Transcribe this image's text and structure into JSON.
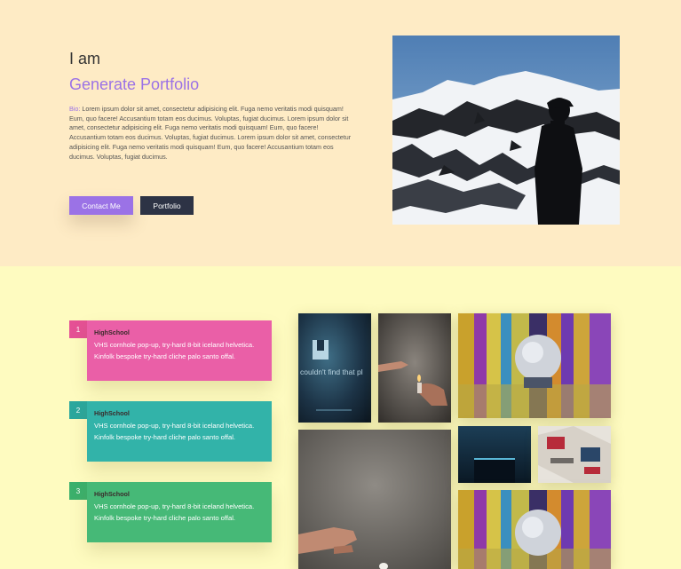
{
  "hero": {
    "greeting": "I am",
    "headline": "Generate Portfolio",
    "bio_label": "Bio:",
    "bio_text": "Lorem ipsum dolor sit amet, consectetur adipisicing elit. Fuga nemo veritatis modi quisquam! Eum, quo facere! Accusantium totam eos ducimus. Voluptas, fugiat ducimus. Lorem ipsum dolor sit amet, consectetur adipisicing elit. Fuga nemo veritatis modi quisquam! Eum, quo facere! Accusantium totam eos ducimus. Voluptas, fugiat ducimus. Lorem ipsum dolor sit amet, consectetur adipisicing elit. Fuga nemo veritatis modi quisquam! Eum, quo facere! Accusantium totam eos ducimus. Voluptas, fugiat ducimus.",
    "contact_button": "Contact Me",
    "portfolio_button": "Portfolio"
  },
  "timeline": [
    {
      "number": "1",
      "title": "HighSchool",
      "text": "VHS cornhole pop-up, try-hard 8-bit iceland helvetica. Kinfolk bespoke try-hard cliche palo santo offal.",
      "color": "#ea5fa7",
      "num_color": "#e55095"
    },
    {
      "number": "2",
      "title": "HighSchool",
      "text": "VHS cornhole pop-up, try-hard 8-bit iceland helvetica. Kinfolk bespoke try-hard cliche palo santo offal.",
      "color": "#32b3a9",
      "num_color": "#2aa79d"
    },
    {
      "number": "3",
      "title": "HighSchool",
      "text": "VHS cornhole pop-up, try-hard 8-bit iceland helvetica. Kinfolk bespoke try-hard cliche palo santo offal.",
      "color": "#46b977",
      "num_color": "#3bb06c"
    }
  ],
  "gallery": {
    "phone_screen_text": "couldn't find that pl"
  },
  "colors": {
    "hero_bg": "#feebc5",
    "section_bg": "#fefbc0",
    "accent": "#9b72e6",
    "dark_button": "#2d3345"
  }
}
